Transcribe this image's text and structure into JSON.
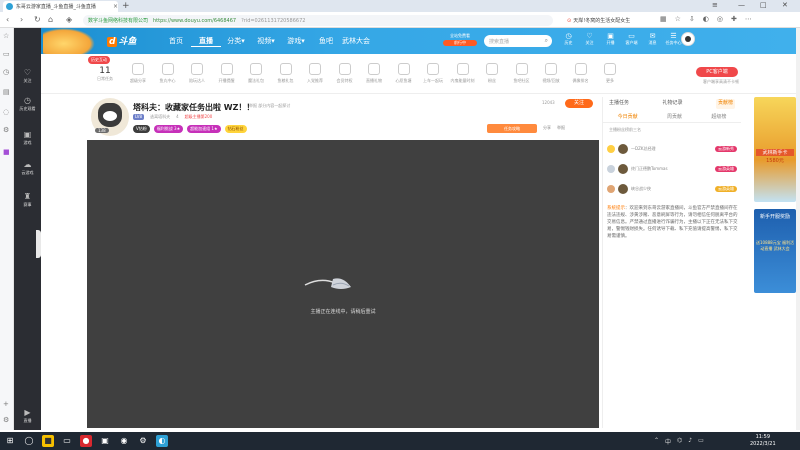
{
  "browser": {
    "tab_title": "东哥云游家直播_斗鱼直播_斗鱼直播",
    "url_security": "数字斗鱼网络科技有限公司",
    "url": "https://www.douyu.com/6468467",
    "url_rest": "?rid=0261131720586672",
    "search_text": "天岸!冬窝的生活女配女生",
    "new_tab": "+"
  },
  "left_rail": {
    "items": [
      {
        "label": "关注",
        "icon": "heart-icon"
      },
      {
        "label": "历史观看",
        "icon": "clock-icon"
      },
      {
        "label": "游戏",
        "icon": "gamepad-icon"
      },
      {
        "label": "云游戏",
        "icon": "cloud-icon"
      },
      {
        "label": "赛事",
        "icon": "trophy-icon"
      }
    ],
    "bottom": "直播"
  },
  "header": {
    "logo": "斗鱼",
    "nav": [
      "首页",
      "直播",
      "分类▾",
      "视频▾",
      "游戏▾",
      "鱼吧",
      "武林大会"
    ],
    "promo_top": "全站免费看",
    "promo_button": "前行中",
    "search_placeholder": "搜索直播",
    "icons": [
      {
        "label": "历史",
        "icon": "history-icon"
      },
      {
        "label": "关注",
        "icon": "follow-icon"
      },
      {
        "label": "开播",
        "icon": "broadcast-icon"
      },
      {
        "label": "客户端",
        "icon": "client-icon"
      },
      {
        "label": "消息",
        "icon": "message-icon"
      },
      {
        "label": "任务中心",
        "icon": "task-icon"
      }
    ]
  },
  "giftbar": {
    "badge": "历史互动",
    "count": "11",
    "count_label": "日常任务",
    "items": [
      "超级分享",
      "鱼丸中心",
      "陪玩达人",
      "开播提醒",
      "魔法礼包",
      "鱼粮礼包",
      "入党推荐",
      "会员特权",
      "直播礼物",
      "心愿鱼塘",
      "上车一起玩",
      "内鬼能量时刻",
      "粉丝",
      "鱼吧社区",
      "视频/回放",
      "偶像排名",
      "更多"
    ],
    "pc_button": "PC客户端",
    "pc_sub": "客户端享高清不卡顿"
  },
  "room": {
    "title": "塔科夫：收藏家任务出啦 WZ！！",
    "share": "举报  部分内容一起探讨",
    "level": "138",
    "tag": "LV8",
    "category": "逃离塔科夫",
    "hot": "4",
    "rank": "超级主播第200",
    "badge_v": "V钻粉",
    "badge_a": "福利挑战 3★",
    "badge_b": "超能加速组 1★",
    "badge_c": "钻石粉丝",
    "fans": "12043",
    "follow": "关注",
    "task": "任务攻略",
    "actions": [
      "分享",
      "举报"
    ]
  },
  "video": {
    "message": "主播正在连线中，请稍后重试"
  },
  "right_panel": {
    "tabs": [
      "主播任务",
      "礼物记录",
      "贡献榜"
    ],
    "active_tab": 2,
    "subtabs": [
      "今日贡献",
      "周贡献",
      "超级榜"
    ],
    "desc": "主播粉丝榜前三名",
    "ranks": [
      {
        "name": "一DZK总经理",
        "badge": "云游新秀"
      },
      {
        "name": "终门正德鹏Tommas",
        "badge": "云游英雄"
      },
      {
        "name": "峡谷战少侠",
        "badge": "云游英雄"
      }
    ],
    "sys_title": "系统提示",
    "sys_text": "：欢迎来到东哥云游家直播间，斗鱼官方严禁直播间存在违法违规、涉黄涉赌、恶意刷屏等行为，请勿相信任何脱离平台的交易信息。严禁通过直播进行诈骗行为，主播以下正在无法私下交易，警惕钱财损失。任何诱导下载、私下充值请提高警惕，私下交易需谨慎。"
  },
  "ad": {
    "top_title": "武林新手卡",
    "top_sub": "1580元",
    "bottom_title": "新手开服奖励",
    "bottom_sub": "送10888元宝 福利活动直播 武林大会"
  },
  "taskbar": {
    "time": "11:59",
    "date": "2022/3/21",
    "tray_ime": "中"
  }
}
